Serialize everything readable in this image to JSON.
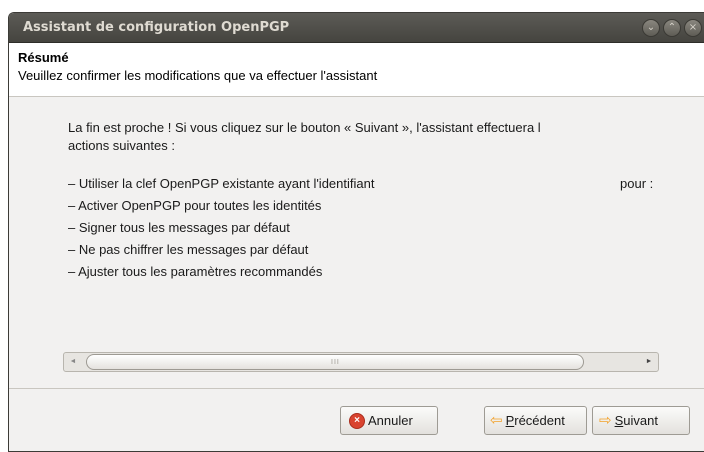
{
  "window": {
    "title": "Assistant de configuration OpenPGP",
    "controls": [
      "⌄",
      "⌃",
      "×"
    ]
  },
  "header": {
    "title": "Résumé",
    "subtitle": "Veuillez confirmer les modifications que va effectuer l'assistant"
  },
  "content": {
    "intro_line1": "La fin est proche ! Si vous cliquez sur le bouton « Suivant », l'assistant effectuera l",
    "intro_line2": "actions suivantes :",
    "actions": [
      {
        "text": "– Utiliser la clef OpenPGP existante ayant l'identifiant",
        "suffix": "pour :"
      },
      {
        "text": "– Activer OpenPGP pour toutes les identités"
      },
      {
        "text": "– Signer tous les messages par défaut"
      },
      {
        "text": "– Ne pas chiffrer les messages par défaut"
      },
      {
        "text": "– Ajuster tous les paramètres recommandés"
      }
    ]
  },
  "scrollbar": {
    "left_arrow": "◄",
    "right_arrow": "►",
    "grip": "III"
  },
  "buttons": {
    "cancel_label": "Annuler",
    "prev_first": "P",
    "prev_rest": "récédent",
    "next_first": "S",
    "next_rest": "uivant"
  },
  "icons": {
    "cancel": "×",
    "prev": "⇦",
    "next": "⇨"
  }
}
